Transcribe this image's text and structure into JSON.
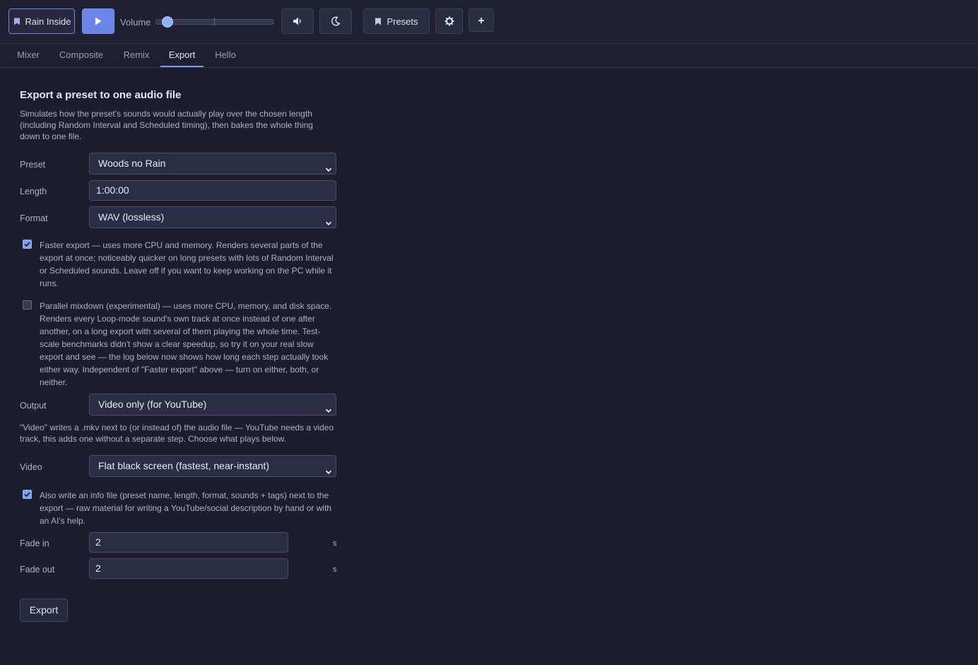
{
  "toolbar": {
    "current_preset_label": "Rain Inside",
    "volume_label": "Volume",
    "volume_value": 0.05,
    "presets_label": "Presets",
    "icons": {
      "bookmark": "bookmark-icon",
      "play": "play-icon",
      "speaker": "speaker-icon",
      "moon": "moon-icon",
      "gear": "gear-icon",
      "plus": "plus-icon"
    },
    "accent_color": "#6b84e8"
  },
  "tabs": [
    {
      "label": "Mixer",
      "active": false
    },
    {
      "label": "Composite",
      "active": false
    },
    {
      "label": "Remix",
      "active": false
    },
    {
      "label": "Export",
      "active": true
    },
    {
      "label": "Hello",
      "active": false
    }
  ],
  "export": {
    "heading": "Export a preset to one audio file",
    "description": "Simulates how the preset's sounds would actually play over the chosen length (including Random Interval and Scheduled timing), then bakes the whole thing down to one file.",
    "preset": {
      "label": "Preset",
      "value": "Woods no Rain"
    },
    "length": {
      "label": "Length",
      "value": "1:00:00"
    },
    "format": {
      "label": "Format",
      "value": "WAV (lossless)"
    },
    "faster_export": {
      "checked": true,
      "text": "Faster export — uses more CPU and memory. Renders several parts of the export at once; noticeably quicker on long presets with lots of Random Interval or Scheduled sounds. Leave off if you want to keep working on the PC while it runs."
    },
    "parallel_mixdown": {
      "checked": false,
      "text": "Parallel mixdown (experimental) — uses more CPU, memory, and disk space. Renders every Loop-mode sound's own track at once instead of one after another, on a long export with several of them playing the whole time. Test-scale benchmarks didn't show a clear speedup, so try it on your real slow export and see — the log below now shows how long each step actually took either way. Independent of \"Faster export\" above — turn on either, both, or neither."
    },
    "output": {
      "label": "Output",
      "value": "Video only (for YouTube)"
    },
    "output_note": "\"Video\" writes a .mkv next to (or instead of) the audio file — YouTube needs a video track, this adds one without a separate step. Choose what plays below.",
    "video": {
      "label": "Video",
      "value": "Flat black screen (fastest, near-instant)"
    },
    "info_file": {
      "checked": true,
      "text": "Also write an info file (preset name, length, format, sounds + tags) next to the export — raw material for writing a YouTube/social description by hand or with an AI's help."
    },
    "fade_in": {
      "label": "Fade in",
      "value": "2",
      "unit": "s"
    },
    "fade_out": {
      "label": "Fade out",
      "value": "2",
      "unit": "s"
    },
    "export_button": "Export"
  }
}
